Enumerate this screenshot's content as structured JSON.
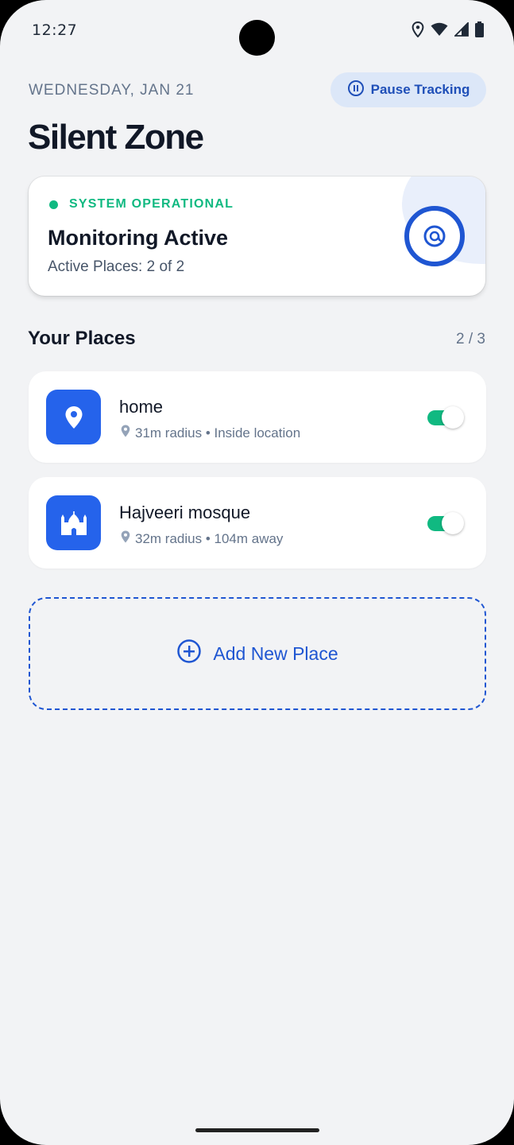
{
  "status_bar": {
    "time": "12:27",
    "icons": [
      "location-icon",
      "wifi-icon",
      "signal-icon",
      "battery-icon"
    ]
  },
  "header": {
    "date": "WEDNESDAY, JAN 21",
    "pause_label": "Pause Tracking",
    "title": "Silent Zone"
  },
  "status_card": {
    "system_status": "SYSTEM OPERATIONAL",
    "title": "Monitoring Active",
    "subtitle": "Active Places: 2 of 2"
  },
  "places": {
    "title": "Your Places",
    "count": "2 / 3",
    "items": [
      {
        "name": "home",
        "meta": "31m radius • Inside location",
        "icon": "location-pin-icon",
        "enabled": true
      },
      {
        "name": "Hajveeri mosque",
        "meta": "32m radius • 104m away",
        "icon": "mosque-icon",
        "enabled": true
      }
    ]
  },
  "add_place": {
    "label": "Add New Place"
  },
  "colors": {
    "accent": "#2563eb",
    "success": "#10b981",
    "background": "#f2f3f5"
  }
}
